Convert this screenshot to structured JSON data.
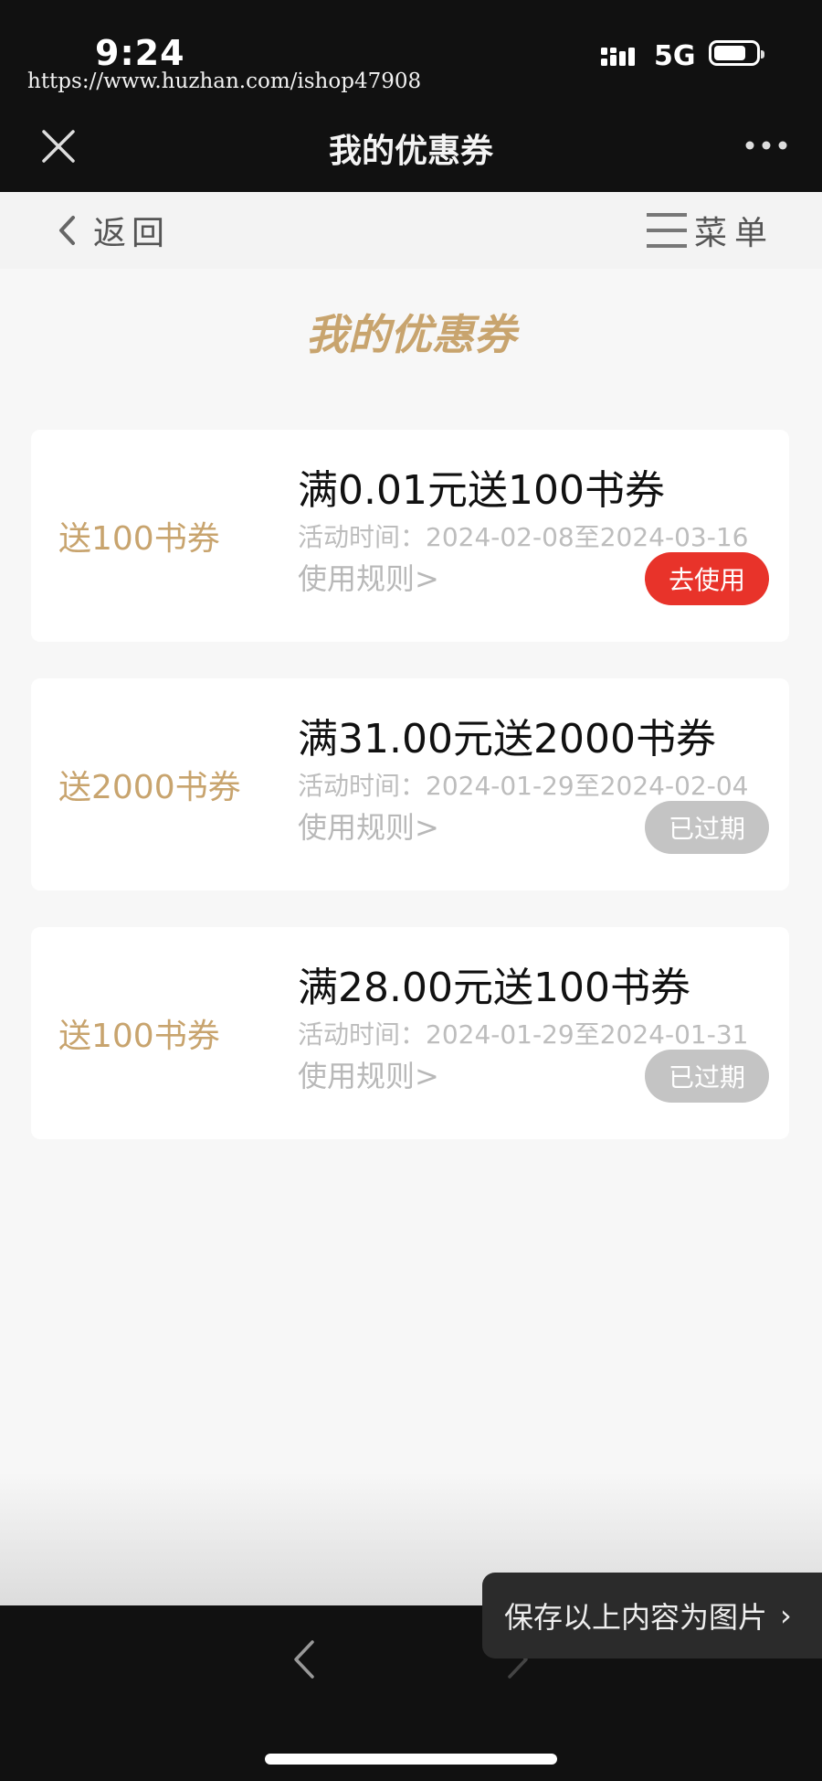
{
  "status_bar": {
    "time": "9:24",
    "watermark": "https://www.huzhan.com/ishop47908",
    "network": "5G",
    "icons": [
      "signal-icon",
      "battery-icon"
    ]
  },
  "nav_bar": {
    "title": "我的优惠券",
    "icons": [
      "close-icon",
      "more-icon"
    ]
  },
  "sub_header": {
    "back_label": "返回",
    "menu_label": "菜单",
    "icons": [
      "chevron-left-icon",
      "menu-icon"
    ]
  },
  "page": {
    "title": "我的优惠券"
  },
  "coupons": [
    {
      "label": "送100书券",
      "title": "满0.01元送100书券",
      "period": "活动时间：2024-02-08至2024-03-16",
      "rules": "使用规则>",
      "button": "去使用",
      "status": "active"
    },
    {
      "label": "送2000书券",
      "title": "满31.00元送2000书券",
      "period": "活动时间：2024-01-29至2024-02-04",
      "rules": "使用规则>",
      "button": "已过期",
      "status": "expired"
    },
    {
      "label": "送100书券",
      "title": "满28.00元送100书券",
      "period": "活动时间：2024-01-29至2024-01-31",
      "rules": "使用规则>",
      "button": "已过期",
      "status": "expired"
    }
  ],
  "save_tooltip": {
    "label": "保存以上内容为图片",
    "chevron": "›"
  },
  "colors": {
    "accent_gold": "#c8a46e",
    "use_button_red": "#e8332a",
    "expired_gray": "#c4c4c4",
    "dark_bar": "#111111"
  }
}
